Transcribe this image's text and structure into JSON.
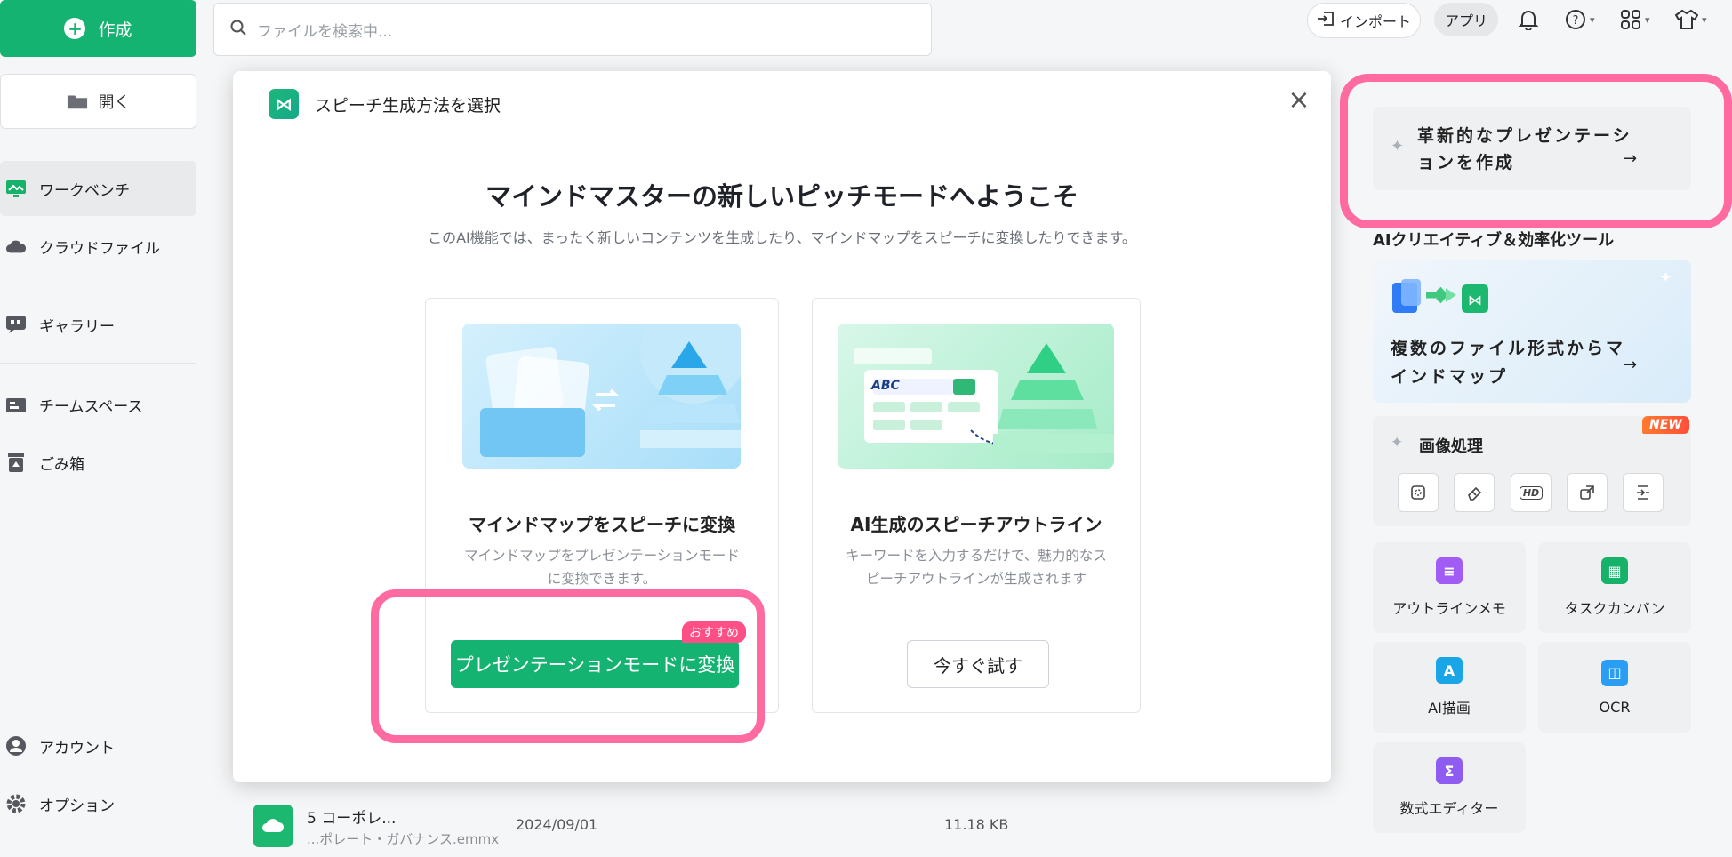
{
  "sidebar": {
    "create_label": "作成",
    "open_label": "開く",
    "items": [
      {
        "label": "ワークベンチ",
        "icon": "workbench-icon"
      },
      {
        "label": "クラウドファイル",
        "icon": "cloud-icon"
      },
      {
        "label": "ギャラリー",
        "icon": "gallery-icon"
      },
      {
        "label": "チームスペース",
        "icon": "team-icon"
      },
      {
        "label": "ごみ箱",
        "icon": "trash-icon"
      }
    ],
    "bottom": [
      {
        "label": "アカウント",
        "icon": "account-icon"
      },
      {
        "label": "オプション",
        "icon": "gear-icon"
      }
    ]
  },
  "topbar": {
    "search_placeholder": "ファイルを検索中...",
    "import_label": "インポート",
    "app_label": "アプリ"
  },
  "file_row": {
    "name_line1": "5 コーポレ...",
    "name_line2": "...ポレート・ガバナンス.emmx",
    "date": "2024/09/01",
    "size": "11.18 KB"
  },
  "modal": {
    "title": "スピーチ生成方法を選択",
    "headline": "マインドマスターの新しいピッチモードへようこそ",
    "subline": "このAI機能では、まったく新しいコンテンツを生成したり、マインドマップをスピーチに変換したりできます。",
    "cards": [
      {
        "title": "マインドマップをスピーチに変換",
        "desc": "マインドマップをプレゼンテーションモードに変換できます。",
        "button": "プレゼンテーションモードに変換",
        "badge": "おすすめ"
      },
      {
        "title": "AI生成のスピーチアウトライン",
        "desc": "キーワードを入力するだけで、魅力的なスピーチアウトラインが生成されます",
        "button": "今すぐ試す",
        "img_text": "ABC"
      }
    ]
  },
  "right_panel": {
    "presentation_card": "革新的なプレゼンテーションを作成",
    "section_title": "AIクリエイティブ＆効率化ツール",
    "multi_file_card": "複数のファイル形式からマインドマップ",
    "image_processing": "画像処理",
    "new_badge": "NEW",
    "hd_label": "HD",
    "tools": [
      {
        "label": "アウトラインメモ",
        "color": "#a05cf5"
      },
      {
        "label": "タスクカンバン",
        "color": "#17b26a"
      },
      {
        "label": "AI描画",
        "color": "#1aa5e6"
      },
      {
        "label": "OCR",
        "color": "#2a9df4"
      },
      {
        "label": "数式エディター",
        "color": "#8f5cf2"
      }
    ],
    "arrow": "→"
  },
  "colors": {
    "accent": "#15b371",
    "highlight": "#ff6aa0",
    "badge": "#ff4f87"
  }
}
